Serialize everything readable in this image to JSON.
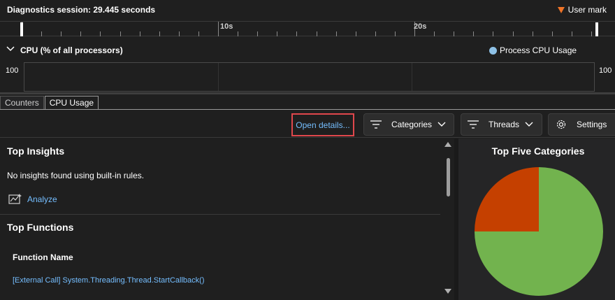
{
  "session": {
    "title": "Diagnostics session: 29.445 seconds",
    "user_mark_label": "User mark",
    "user_mark_color": "#f07427"
  },
  "ruler": {
    "tick_labels": [
      "10s",
      "20s"
    ]
  },
  "cpu_graph": {
    "title": "CPU (% of all processors)",
    "legend_label": "Process CPU Usage",
    "legend_color": "#8ec1e6",
    "axis_max_left": "100",
    "axis_max_right": "100"
  },
  "tabs": [
    {
      "label": "Counters",
      "active": false
    },
    {
      "label": "CPU Usage",
      "active": true
    }
  ],
  "toolbar": {
    "open_details": "Open details...",
    "categories": "Categories",
    "threads": "Threads",
    "settings": "Settings"
  },
  "insights": {
    "title": "Top Insights",
    "message": "No insights found using built-in rules.",
    "analyze_label": "Analyze"
  },
  "functions": {
    "title": "Top Functions",
    "column_header": "Function Name",
    "rows": [
      "[External Call] System.Threading.Thread.StartCallback()"
    ]
  },
  "categories_panel": {
    "title": "Top Five Categories"
  },
  "chart_data": {
    "type": "pie",
    "title": "Top Five Categories",
    "slices": [
      {
        "value": 75,
        "color": "#72b34e"
      },
      {
        "value": 25,
        "color": "#c54000"
      }
    ]
  }
}
